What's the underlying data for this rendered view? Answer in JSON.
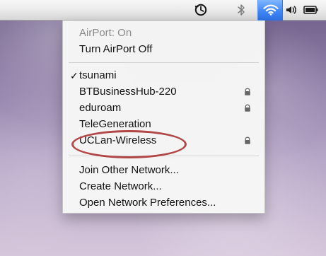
{
  "menu_bar": {
    "icons": {
      "time_machine": "time-machine-icon",
      "bluetooth": "bluetooth-icon",
      "airport": "airport-icon",
      "volume": "volume-icon",
      "battery": "battery-icon"
    }
  },
  "airport_menu": {
    "status": {
      "label": "AirPort: On"
    },
    "turn_off": {
      "label": "Turn AirPort Off"
    },
    "networks": [
      {
        "label": "tsunami",
        "checked": true,
        "secure": false
      },
      {
        "label": "BTBusinessHub-220",
        "checked": false,
        "secure": true
      },
      {
        "label": "eduroam",
        "checked": false,
        "secure": true
      },
      {
        "label": "TeleGeneration",
        "checked": false,
        "secure": false
      },
      {
        "label": "UCLan-Wireless",
        "checked": false,
        "secure": true
      }
    ],
    "actions": [
      {
        "label": "Join Other Network..."
      },
      {
        "label": "Create Network..."
      },
      {
        "label": "Open Network Preferences..."
      }
    ],
    "check_symbol": "✓"
  },
  "colors": {
    "highlight": "#b24646",
    "airport_active": "#3f87f7"
  }
}
